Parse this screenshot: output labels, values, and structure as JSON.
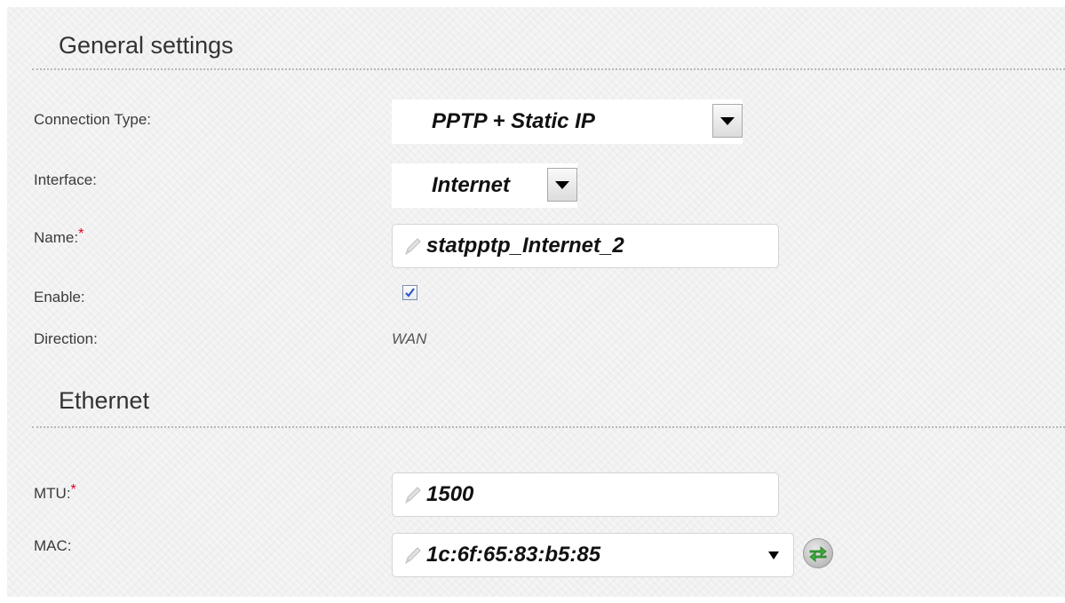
{
  "general_settings": {
    "title": "General settings",
    "connection_type": {
      "label": "Connection Type:",
      "value": "PPTP + Static IP"
    },
    "interface": {
      "label": "Interface:",
      "value": "Internet"
    },
    "name": {
      "label": "Name:",
      "required_mark": "*",
      "value": "statpptp_Internet_2"
    },
    "enable": {
      "label": "Enable:",
      "checked": true
    },
    "direction": {
      "label": "Direction:",
      "value": "WAN"
    }
  },
  "ethernet": {
    "title": "Ethernet",
    "mtu": {
      "label": "MTU:",
      "required_mark": "*",
      "value": "1500"
    },
    "mac": {
      "label": "MAC:",
      "value": "1c:6f:65:83:b5:85"
    }
  },
  "icons": {
    "edit": "pencil-icon",
    "dropdown": "chevron-down-icon",
    "check": "check-icon",
    "refresh": "refresh-icon"
  },
  "colors": {
    "required": "#e0001a",
    "refresh_arrow": "#3aa83a",
    "check": "#2c58c9"
  }
}
